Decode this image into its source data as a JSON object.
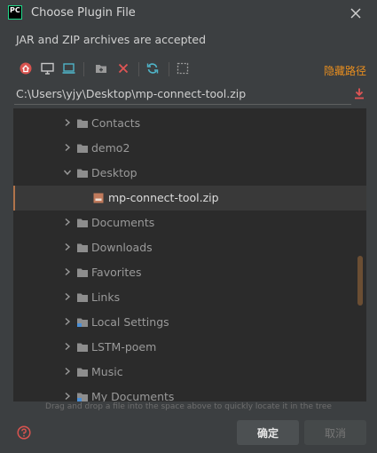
{
  "window": {
    "app_icon_text": "PC",
    "title": "Choose Plugin File"
  },
  "subtitle": "JAR and ZIP archives are accepted",
  "toolbar": {
    "icons": [
      "home-icon",
      "desktop-icon",
      "project-icon",
      "new-folder-icon",
      "delete-icon",
      "refresh-icon",
      "toggle-hidden-icon"
    ],
    "hide_path_label": "隐藏路径"
  },
  "path": {
    "value": "C:\\Users\\yjy\\Desktop\\mp-connect-tool.zip"
  },
  "tree": {
    "items": [
      {
        "label": "Contacts",
        "expanded": false
      },
      {
        "label": "demo2",
        "expanded": false
      },
      {
        "label": "Desktop",
        "expanded": true
      },
      {
        "label": "mp-connect-tool.zip",
        "selected": true
      },
      {
        "label": "Documents",
        "expanded": false
      },
      {
        "label": "Downloads",
        "expanded": false
      },
      {
        "label": "Favorites",
        "expanded": false
      },
      {
        "label": "Links",
        "expanded": false
      },
      {
        "label": "Local Settings",
        "expanded": false
      },
      {
        "label": "LSTM-poem",
        "expanded": false
      },
      {
        "label": "Music",
        "expanded": false
      },
      {
        "label": "My Documents",
        "expanded": false
      }
    ]
  },
  "hint": "Drag and drop a file into the space above to quickly locate it in the tree",
  "buttons": {
    "ok": "确定",
    "cancel": "取消"
  },
  "colors": {
    "accent": "#e88e1f",
    "background": "#3c3f41",
    "tree_background": "#2b2b2b"
  }
}
